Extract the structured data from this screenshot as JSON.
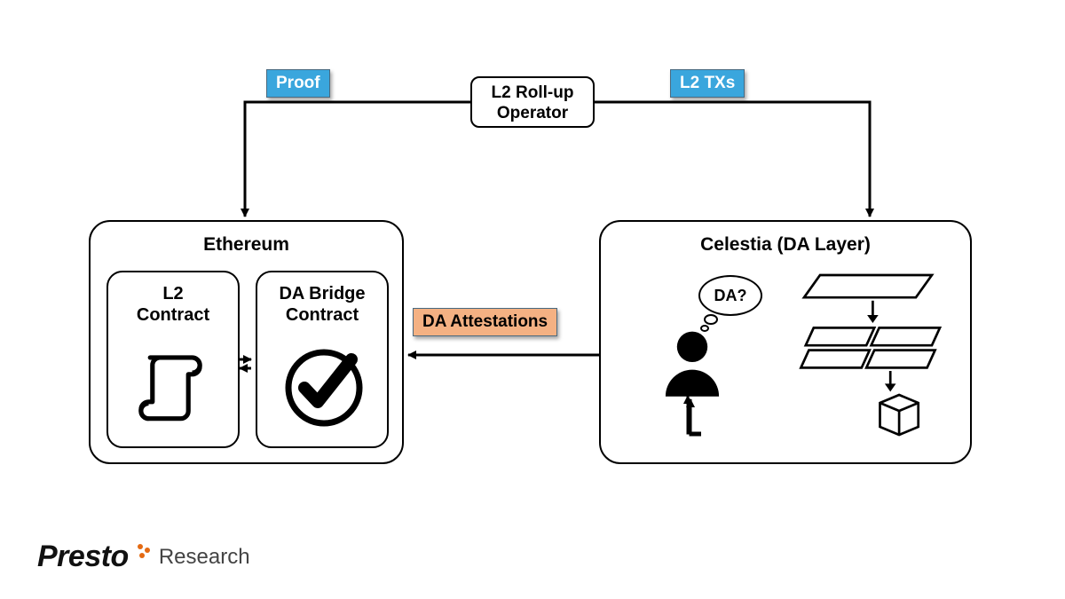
{
  "top_operator": {
    "line1": "L2 Roll-up",
    "line2": "Operator"
  },
  "labels": {
    "proof": "Proof",
    "l2txs": "L2 TXs",
    "da_attestations": "DA Attestations"
  },
  "ethereum": {
    "title": "Ethereum",
    "l2_contract": {
      "line1": "L2",
      "line2": "Contract"
    },
    "da_bridge": {
      "line1": "DA Bridge",
      "line2": "Contract"
    }
  },
  "celestia": {
    "title": "Celestia (DA Layer)",
    "speech": "DA?"
  },
  "brand": {
    "name": "Presto",
    "sub": "Research"
  }
}
